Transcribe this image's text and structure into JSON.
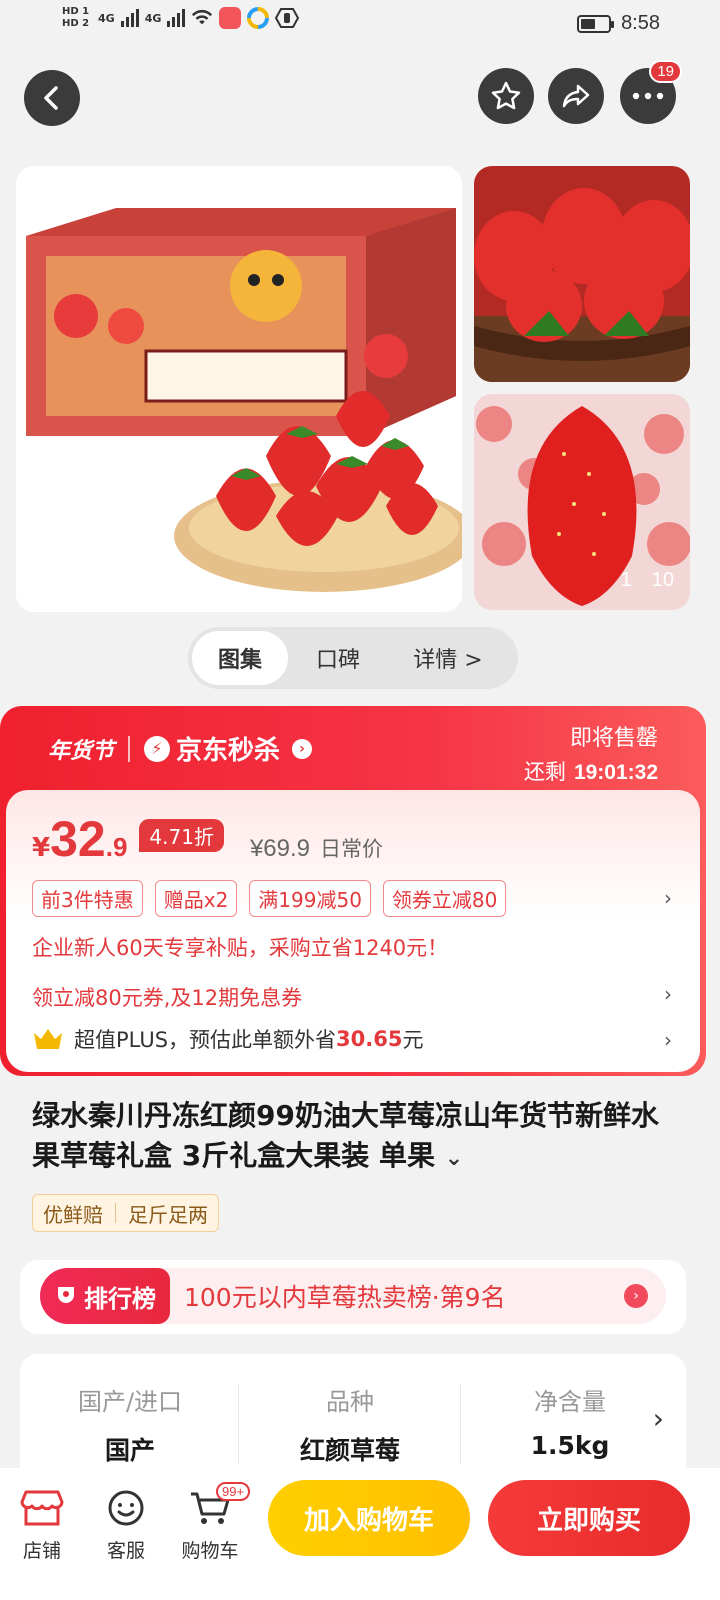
{
  "status_bar": {
    "hd1": "HD 1",
    "hd2": "HD 2",
    "net1": "4G",
    "net2": "4G",
    "time": "8:58"
  },
  "header": {
    "more_badge": "19",
    "icons": [
      "back-icon",
      "star-icon",
      "share-icon",
      "more-icon"
    ]
  },
  "gallery": {
    "counter_current": "1",
    "counter_total": "10"
  },
  "tabs": [
    {
      "label": "图集"
    },
    {
      "label": "口碑"
    },
    {
      "label": "详情 >"
    }
  ],
  "seckill": {
    "festival": "年货节",
    "brand": "京东秒杀",
    "soon": "即将售罄",
    "remain_label": "还剩",
    "remain_time": "19:01:32",
    "yen": "¥",
    "price_int": "32",
    "price_dec": ".9",
    "discount": "4.71折",
    "orig_price": "¥69.9",
    "orig_label": "日常价",
    "tags": [
      "前3件特惠",
      "赠品x2",
      "满199减50",
      "领券立减80"
    ],
    "subsidy": "企业新人60天专享补贴，采购立省1240元！",
    "coupon": "领立减80元券,及12期免息券",
    "plus_prefix": "超值PLUS，预估此单额外省",
    "plus_amount": "30.65",
    "plus_suffix": "元"
  },
  "product": {
    "title": "绿水秦川丹冻红颜99奶油大草莓凉山年货节新鲜水果草莓礼盒 3斤礼盒大果装 单果",
    "guarantees": [
      "优鲜赔",
      "足斤足两"
    ]
  },
  "ranking": {
    "label": "排行榜",
    "text": "100元以内草莓热卖榜·第9名"
  },
  "specs": [
    {
      "key": "国产/进口",
      "value": "国产"
    },
    {
      "key": "品种",
      "value": "红颜草莓"
    },
    {
      "key": "净含量",
      "value": "1.5kg"
    }
  ],
  "bottom_bar": {
    "shop": "店铺",
    "service": "客服",
    "cart": "购物车",
    "cart_badge": "99+",
    "add_to_cart": "加入购物车",
    "buy_now": "立即购买"
  },
  "colors": {
    "accent": "#e4393c",
    "add_cart": "#ffc400",
    "buy": "#ef3030"
  }
}
